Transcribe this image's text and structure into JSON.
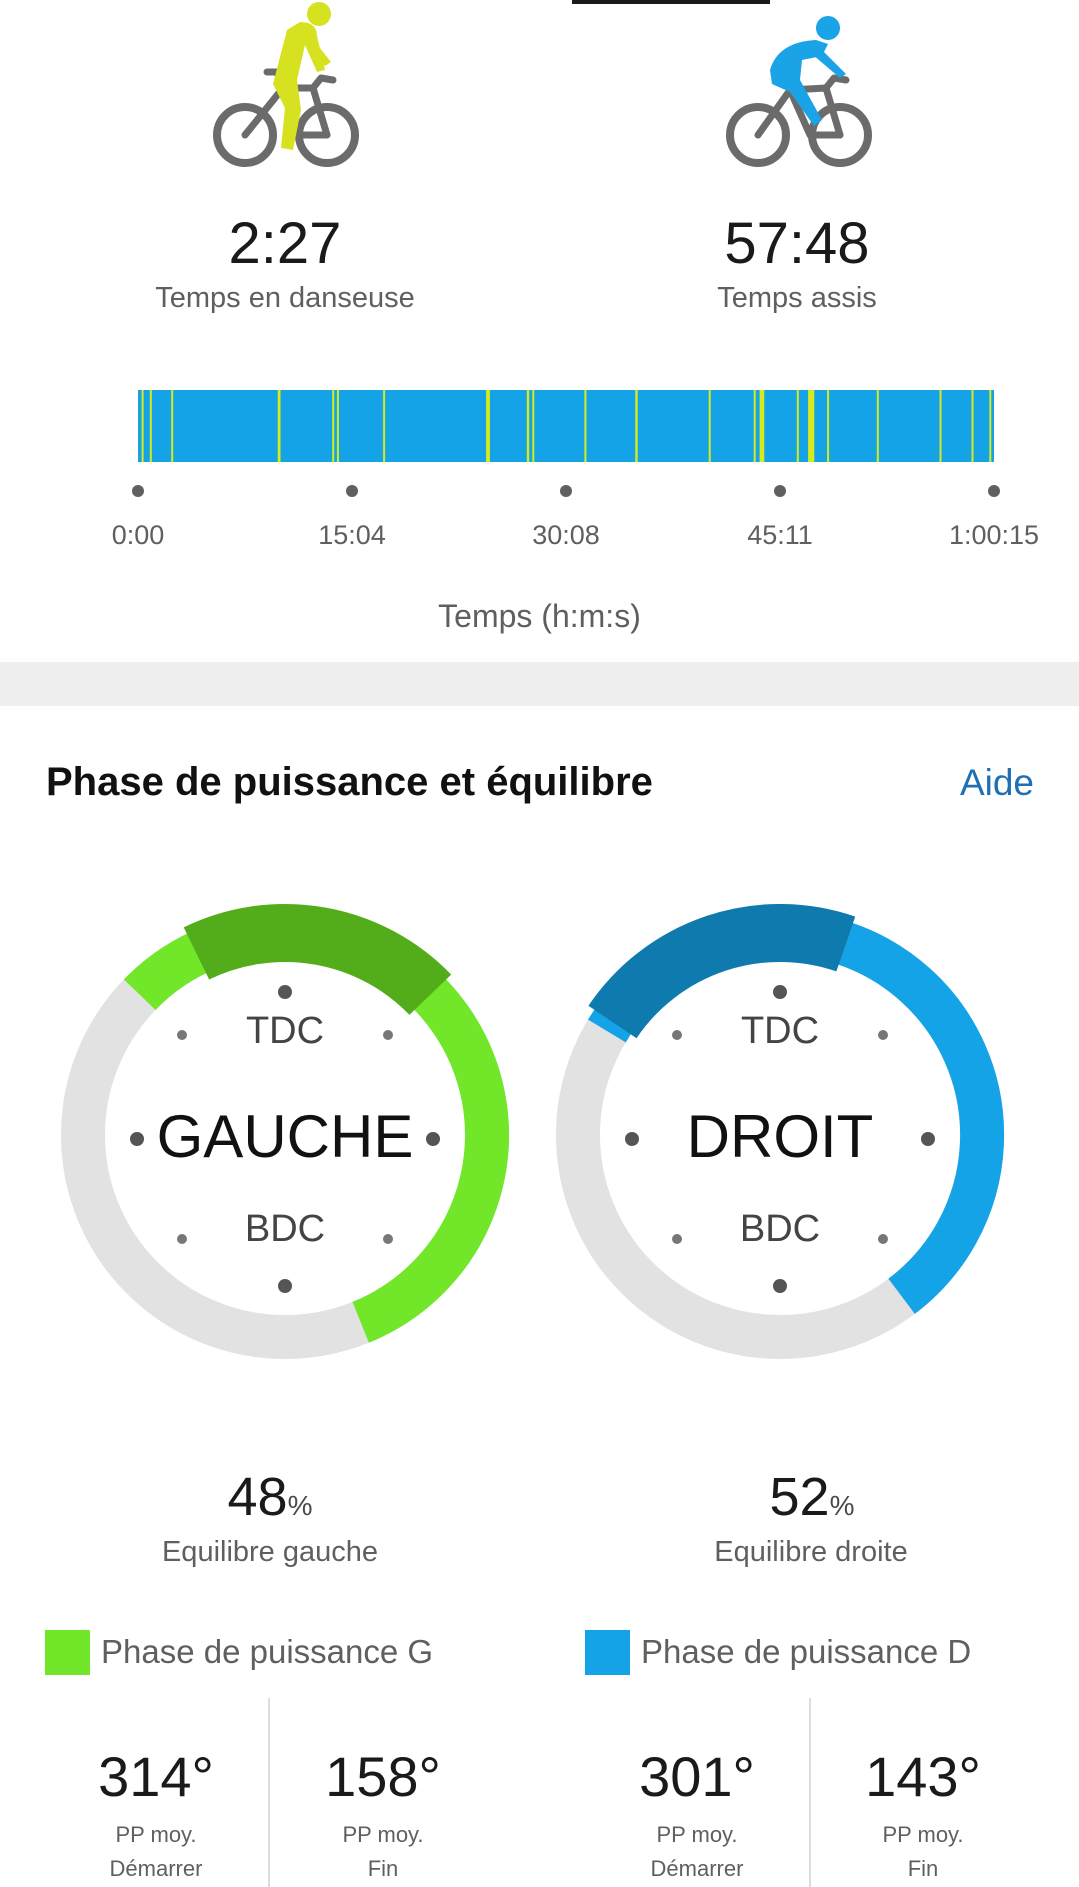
{
  "riders": {
    "standing": {
      "time": "2:27",
      "label": "Temps en danseuse",
      "color": "#d6e21f"
    },
    "seated": {
      "time": "57:48",
      "label": "Temps assis",
      "color": "#1aa3e6"
    }
  },
  "chart_data": {
    "type": "timeline",
    "xlabel": "Temps (h:m:s)",
    "x_ticks": [
      "0:00",
      "15:04",
      "30:08",
      "45:11",
      "1:00:15"
    ],
    "x_range_seconds": [
      0,
      3615
    ],
    "series": [
      {
        "name": "Temps assis",
        "color": "#13a3e6"
      },
      {
        "name": "Temps en danseuse",
        "color": "#d9ea1c"
      }
    ],
    "standing_segments_seconds": [
      [
        15,
        20
      ],
      [
        50,
        54
      ],
      [
        140,
        146
      ],
      [
        590,
        602
      ],
      [
        820,
        826
      ],
      [
        840,
        845
      ],
      [
        1035,
        1041
      ],
      [
        1470,
        1486
      ],
      [
        1642,
        1652
      ],
      [
        1665,
        1672
      ],
      [
        1885,
        1890
      ],
      [
        2100,
        2110
      ],
      [
        2410,
        2416
      ],
      [
        2600,
        2607
      ],
      [
        2625,
        2645
      ],
      [
        2782,
        2787
      ],
      [
        2830,
        2856
      ],
      [
        2910,
        2915
      ],
      [
        3120,
        3125
      ],
      [
        3385,
        3390
      ],
      [
        3520,
        3526
      ],
      [
        3595,
        3603
      ]
    ]
  },
  "section": {
    "title": "Phase de puissance et équilibre",
    "help": "Aide"
  },
  "dials": {
    "left": {
      "name": "GAUCHE",
      "top": "TDC",
      "bottom": "BDC"
    },
    "right": {
      "name": "DROIT",
      "top": "TDC",
      "bottom": "BDC"
    }
  },
  "balance": {
    "left": {
      "value": "48",
      "unit": "%",
      "label": "Equilibre gauche"
    },
    "right": {
      "value": "52",
      "unit": "%",
      "label": "Equilibre droite"
    }
  },
  "power_phase": {
    "left": {
      "label": "Phase de puissance G",
      "color": "#72e629",
      "peak_color": "#53ad1a",
      "start": {
        "value": "314°",
        "line1": "PP moy.",
        "line2": "Démarrer"
      },
      "end": {
        "value": "158°",
        "line1": "PP moy.",
        "line2": "Fin"
      }
    },
    "right": {
      "label": "Phase de puissance D",
      "color": "#13a3e6",
      "peak_color": "#0f7aad",
      "start": {
        "value": "301°",
        "line1": "PP moy.",
        "line2": "Démarrer"
      },
      "end": {
        "value": "143°",
        "line1": "PP moy.",
        "line2": "Fin"
      }
    }
  }
}
